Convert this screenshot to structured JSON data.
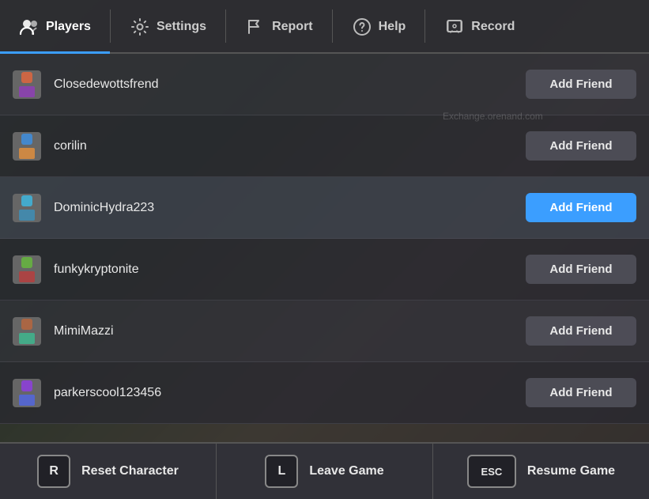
{
  "navbar": {
    "items": [
      {
        "id": "players",
        "label": "Players",
        "active": true
      },
      {
        "id": "settings",
        "label": "Settings",
        "active": false
      },
      {
        "id": "report",
        "label": "Report",
        "active": false
      },
      {
        "id": "help",
        "label": "Help",
        "active": false
      },
      {
        "id": "record",
        "label": "Record",
        "active": false
      }
    ]
  },
  "players": [
    {
      "id": 1,
      "name": "Closedewottsfrend",
      "addFriendHighlight": false
    },
    {
      "id": 2,
      "name": "corilin",
      "addFriendHighlight": false
    },
    {
      "id": 3,
      "name": "DominicHydra223",
      "addFriendHighlight": true
    },
    {
      "id": 4,
      "name": "funkykryptonite",
      "addFriendHighlight": false
    },
    {
      "id": 5,
      "name": "MimiMazzi",
      "addFriendHighlight": false
    },
    {
      "id": 6,
      "name": "parkerscool123456",
      "addFriendHighlight": false
    }
  ],
  "addFriendLabel": "Add Friend",
  "watermark": "Exchange.orenand.com",
  "bottomBar": {
    "buttons": [
      {
        "id": "reset",
        "key": "R",
        "label": "Reset Character",
        "wide": false
      },
      {
        "id": "leave",
        "key": "L",
        "label": "Leave Game",
        "wide": false
      },
      {
        "id": "resume",
        "key": "ESC",
        "label": "Resume Game",
        "wide": true
      }
    ]
  }
}
